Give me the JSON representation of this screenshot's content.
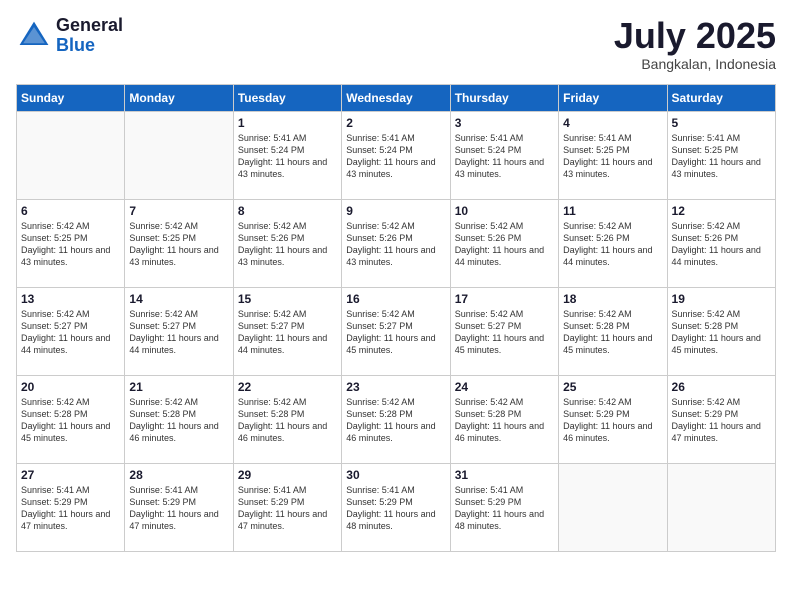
{
  "header": {
    "logo_general": "General",
    "logo_blue": "Blue",
    "month_title": "July 2025",
    "location": "Bangkalan, Indonesia"
  },
  "weekdays": [
    "Sunday",
    "Monday",
    "Tuesday",
    "Wednesday",
    "Thursday",
    "Friday",
    "Saturday"
  ],
  "weeks": [
    [
      {
        "day": "",
        "content": ""
      },
      {
        "day": "",
        "content": ""
      },
      {
        "day": "1",
        "content": "Sunrise: 5:41 AM\nSunset: 5:24 PM\nDaylight: 11 hours and 43 minutes."
      },
      {
        "day": "2",
        "content": "Sunrise: 5:41 AM\nSunset: 5:24 PM\nDaylight: 11 hours and 43 minutes."
      },
      {
        "day": "3",
        "content": "Sunrise: 5:41 AM\nSunset: 5:24 PM\nDaylight: 11 hours and 43 minutes."
      },
      {
        "day": "4",
        "content": "Sunrise: 5:41 AM\nSunset: 5:25 PM\nDaylight: 11 hours and 43 minutes."
      },
      {
        "day": "5",
        "content": "Sunrise: 5:41 AM\nSunset: 5:25 PM\nDaylight: 11 hours and 43 minutes."
      }
    ],
    [
      {
        "day": "6",
        "content": "Sunrise: 5:42 AM\nSunset: 5:25 PM\nDaylight: 11 hours and 43 minutes."
      },
      {
        "day": "7",
        "content": "Sunrise: 5:42 AM\nSunset: 5:25 PM\nDaylight: 11 hours and 43 minutes."
      },
      {
        "day": "8",
        "content": "Sunrise: 5:42 AM\nSunset: 5:26 PM\nDaylight: 11 hours and 43 minutes."
      },
      {
        "day": "9",
        "content": "Sunrise: 5:42 AM\nSunset: 5:26 PM\nDaylight: 11 hours and 43 minutes."
      },
      {
        "day": "10",
        "content": "Sunrise: 5:42 AM\nSunset: 5:26 PM\nDaylight: 11 hours and 44 minutes."
      },
      {
        "day": "11",
        "content": "Sunrise: 5:42 AM\nSunset: 5:26 PM\nDaylight: 11 hours and 44 minutes."
      },
      {
        "day": "12",
        "content": "Sunrise: 5:42 AM\nSunset: 5:26 PM\nDaylight: 11 hours and 44 minutes."
      }
    ],
    [
      {
        "day": "13",
        "content": "Sunrise: 5:42 AM\nSunset: 5:27 PM\nDaylight: 11 hours and 44 minutes."
      },
      {
        "day": "14",
        "content": "Sunrise: 5:42 AM\nSunset: 5:27 PM\nDaylight: 11 hours and 44 minutes."
      },
      {
        "day": "15",
        "content": "Sunrise: 5:42 AM\nSunset: 5:27 PM\nDaylight: 11 hours and 44 minutes."
      },
      {
        "day": "16",
        "content": "Sunrise: 5:42 AM\nSunset: 5:27 PM\nDaylight: 11 hours and 45 minutes."
      },
      {
        "day": "17",
        "content": "Sunrise: 5:42 AM\nSunset: 5:27 PM\nDaylight: 11 hours and 45 minutes."
      },
      {
        "day": "18",
        "content": "Sunrise: 5:42 AM\nSunset: 5:28 PM\nDaylight: 11 hours and 45 minutes."
      },
      {
        "day": "19",
        "content": "Sunrise: 5:42 AM\nSunset: 5:28 PM\nDaylight: 11 hours and 45 minutes."
      }
    ],
    [
      {
        "day": "20",
        "content": "Sunrise: 5:42 AM\nSunset: 5:28 PM\nDaylight: 11 hours and 45 minutes."
      },
      {
        "day": "21",
        "content": "Sunrise: 5:42 AM\nSunset: 5:28 PM\nDaylight: 11 hours and 46 minutes."
      },
      {
        "day": "22",
        "content": "Sunrise: 5:42 AM\nSunset: 5:28 PM\nDaylight: 11 hours and 46 minutes."
      },
      {
        "day": "23",
        "content": "Sunrise: 5:42 AM\nSunset: 5:28 PM\nDaylight: 11 hours and 46 minutes."
      },
      {
        "day": "24",
        "content": "Sunrise: 5:42 AM\nSunset: 5:28 PM\nDaylight: 11 hours and 46 minutes."
      },
      {
        "day": "25",
        "content": "Sunrise: 5:42 AM\nSunset: 5:29 PM\nDaylight: 11 hours and 46 minutes."
      },
      {
        "day": "26",
        "content": "Sunrise: 5:42 AM\nSunset: 5:29 PM\nDaylight: 11 hours and 47 minutes."
      }
    ],
    [
      {
        "day": "27",
        "content": "Sunrise: 5:41 AM\nSunset: 5:29 PM\nDaylight: 11 hours and 47 minutes."
      },
      {
        "day": "28",
        "content": "Sunrise: 5:41 AM\nSunset: 5:29 PM\nDaylight: 11 hours and 47 minutes."
      },
      {
        "day": "29",
        "content": "Sunrise: 5:41 AM\nSunset: 5:29 PM\nDaylight: 11 hours and 47 minutes."
      },
      {
        "day": "30",
        "content": "Sunrise: 5:41 AM\nSunset: 5:29 PM\nDaylight: 11 hours and 48 minutes."
      },
      {
        "day": "31",
        "content": "Sunrise: 5:41 AM\nSunset: 5:29 PM\nDaylight: 11 hours and 48 minutes."
      },
      {
        "day": "",
        "content": ""
      },
      {
        "day": "",
        "content": ""
      }
    ]
  ]
}
